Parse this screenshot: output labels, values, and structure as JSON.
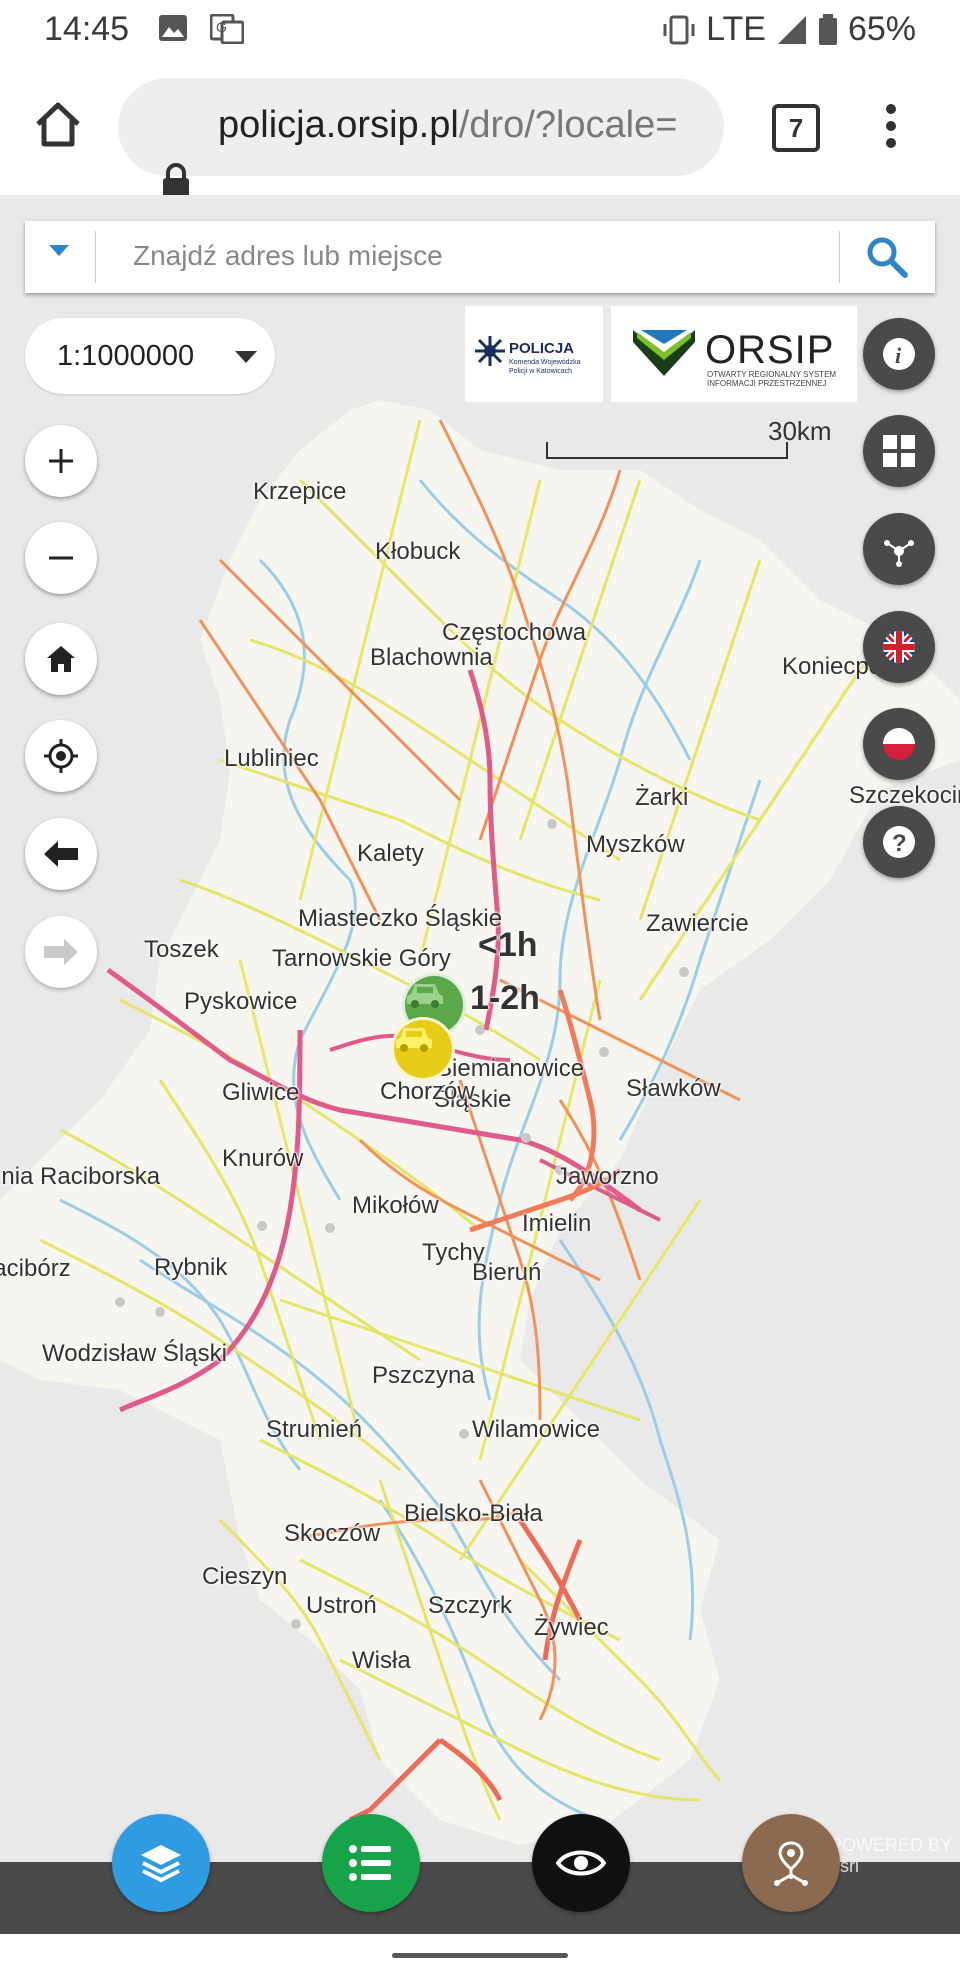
{
  "status_bar": {
    "time": "14:45",
    "network": "LTE",
    "battery": "65%"
  },
  "browser": {
    "url_domain": "policja.orsip.pl",
    "url_rest": "/dro/?locale=",
    "tab_count": "7"
  },
  "search": {
    "placeholder": "Znajdź adres lub miejsce"
  },
  "scale_select": {
    "value": "1:1000000"
  },
  "logos": {
    "police_title": "POLICJA",
    "police_subtitle": "Komenda Wojewódzka Policji w Katowicach",
    "orsip_title": "ORSIP",
    "orsip_subtitle": "OTWARTY REGIONALNY SYSTEM INFORMACJI PRZESTRZENNEJ"
  },
  "scale_bar": {
    "label": "30km"
  },
  "map": {
    "places": [
      {
        "name": "Krzepice"
      },
      {
        "name": "Kłobuck"
      },
      {
        "name": "Częstochowa"
      },
      {
        "name": "Blachownia"
      },
      {
        "name": "Koniecpol"
      },
      {
        "name": "Lubliniec"
      },
      {
        "name": "Żarki"
      },
      {
        "name": "Szczekociny"
      },
      {
        "name": "Myszków"
      },
      {
        "name": "Kalety"
      },
      {
        "name": "Miasteczko Śląskie"
      },
      {
        "name": "Zawiercie"
      },
      {
        "name": "Toszek"
      },
      {
        "name": "Tarnowskie Góry"
      },
      {
        "name": "Pyskowice"
      },
      {
        "name": "Siemianowice"
      },
      {
        "name": "Śląskie"
      },
      {
        "name": "Sławków"
      },
      {
        "name": "Gliwice"
      },
      {
        "name": "Chorzów"
      },
      {
        "name": "Knurów"
      },
      {
        "name": "Jaworzno"
      },
      {
        "name": "Kuźnia Raciborska"
      },
      {
        "name": "Mikołów"
      },
      {
        "name": "Imielin"
      },
      {
        "name": "Racibórz"
      },
      {
        "name": "Rybnik"
      },
      {
        "name": "Tychy"
      },
      {
        "name": "Bieruń"
      },
      {
        "name": "Wodzisław Śląski"
      },
      {
        "name": "Pszczyna"
      },
      {
        "name": "Strumień"
      },
      {
        "name": "Wilamowice"
      },
      {
        "name": "Bielsko-Biała"
      },
      {
        "name": "Skoczów"
      },
      {
        "name": "Cieszyn"
      },
      {
        "name": "Ustroń"
      },
      {
        "name": "Szczyrk"
      },
      {
        "name": "Żywiec"
      },
      {
        "name": "Wisła"
      }
    ],
    "delay_labels": [
      "<1h",
      "1-2h"
    ],
    "markers": [
      {
        "name": "car-marker-green",
        "color": "#5aa84a"
      },
      {
        "name": "car-marker-yellow",
        "color": "#e6cd18"
      }
    ],
    "road_colors": {
      "motorway": "#e05a8a",
      "national": "#f0935a",
      "regional": "#e4e66a",
      "river": "#9ccde6"
    }
  },
  "right_controls": [
    "info",
    "basemap-gallery",
    "share",
    "english",
    "polish",
    "help"
  ],
  "left_controls": [
    "zoom-in",
    "zoom-out",
    "home",
    "locate",
    "back",
    "forward"
  ],
  "bottom": {
    "watermark": "POWERED BY esri",
    "colors": {
      "layers": "#2f9be0",
      "legend": "#17a34a",
      "visibility": "#111111",
      "routing": "#8c6a50"
    }
  }
}
